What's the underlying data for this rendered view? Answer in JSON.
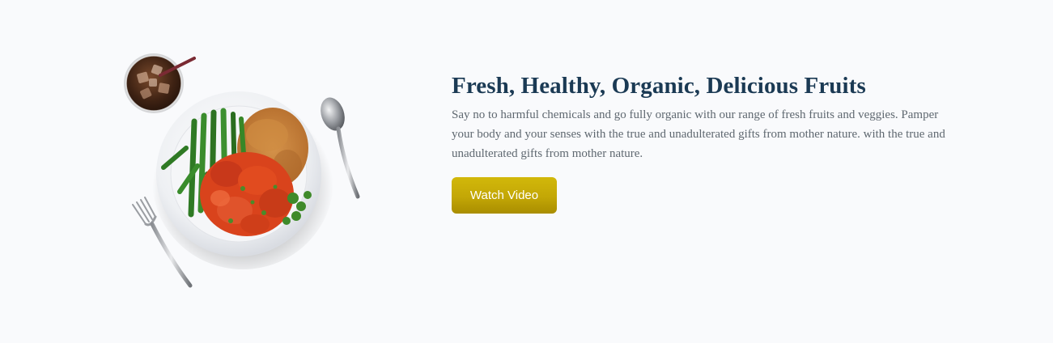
{
  "hero": {
    "title": "Fresh, Healthy, Organic, Delicious Fruits",
    "description": "Say no to harmful chemicals and go fully organic with our range of fresh fruits and veggies. Pamper your body and your senses with the true and unadulterated gifts from mother nature. with the true and unadulterated gifts from mother nature.",
    "button_label": "Watch Video"
  },
  "colors": {
    "background": "#f9fafc",
    "title": "#1b3a54",
    "text": "#5f6870",
    "button": "#c3a706"
  },
  "illustration": {
    "icon": "food-plate-image"
  }
}
